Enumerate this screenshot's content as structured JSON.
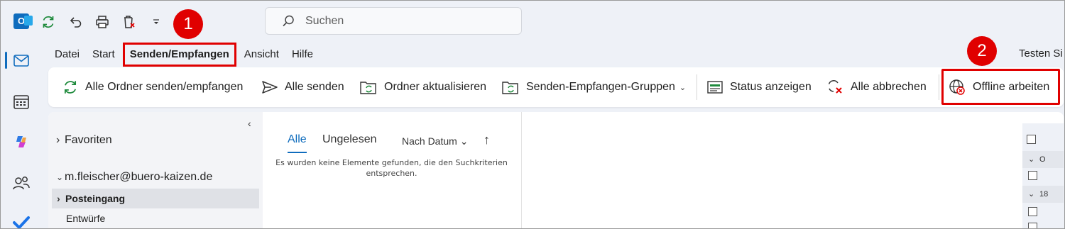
{
  "window": {
    "search_placeholder": "Suchen",
    "user": "Testen Si"
  },
  "callouts": [
    "1",
    "2"
  ],
  "menu_tabs": [
    "Datei",
    "Start",
    "Senden/Empfangen",
    "Ansicht",
    "Hilfe"
  ],
  "ribbon": {
    "send_receive_all": "Alle Ordner senden/empfangen",
    "send_all": "Alle senden",
    "update_folder": "Ordner aktualisieren",
    "groups": "Senden-Empfangen-Gruppen",
    "show_status": "Status anzeigen",
    "cancel_all": "Alle abbrechen",
    "work_offline": "Offline arbeiten"
  },
  "folder_pane": {
    "favorites": "Favoriten",
    "account": "m.fleischer@buero-kaizen.de",
    "inbox": "Posteingang",
    "drafts": "Entwürfe"
  },
  "message_list": {
    "tab_all": "Alle",
    "tab_unread": "Ungelesen",
    "sort": "Nach Datum",
    "empty": "Es wurden keine Elemente gefunden, die den Suchkriterien entsprechen."
  },
  "right_strip": {
    "row1": "O",
    "row2": "18"
  },
  "colors": {
    "accent": "#0f6cbd",
    "highlight": "#e00000",
    "sync_green": "#1e8a3c"
  }
}
